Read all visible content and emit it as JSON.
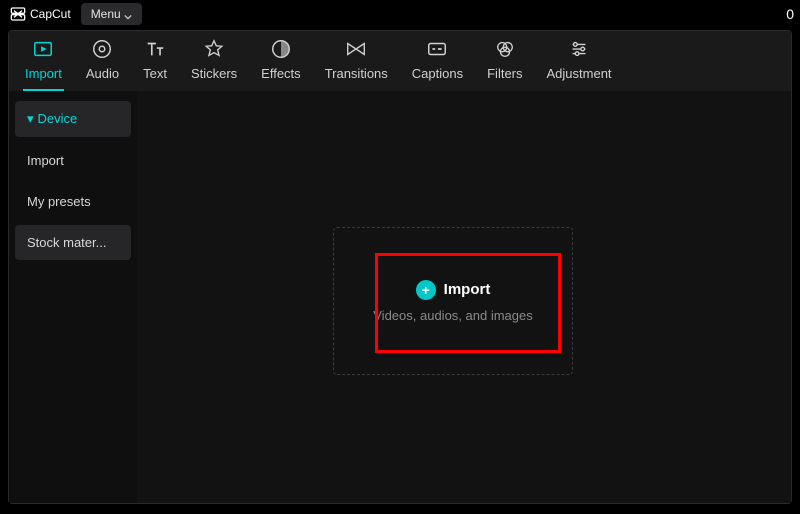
{
  "app": {
    "name": "CapCut",
    "menu_label": "Menu",
    "topright": "0"
  },
  "toolbar": {
    "items": [
      {
        "label": "Import"
      },
      {
        "label": "Audio"
      },
      {
        "label": "Text"
      },
      {
        "label": "Stickers"
      },
      {
        "label": "Effects"
      },
      {
        "label": "Transitions"
      },
      {
        "label": "Captions"
      },
      {
        "label": "Filters"
      },
      {
        "label": "Adjustment"
      }
    ]
  },
  "sidebar": {
    "items": [
      {
        "label": "Device"
      },
      {
        "label": "Import"
      },
      {
        "label": "My presets"
      },
      {
        "label": "Stock mater..."
      }
    ]
  },
  "import_panel": {
    "title": "Import",
    "subtitle": "Videos, audios, and images"
  },
  "colors": {
    "accent": "#00d8d8",
    "highlight": "#ff0000"
  }
}
